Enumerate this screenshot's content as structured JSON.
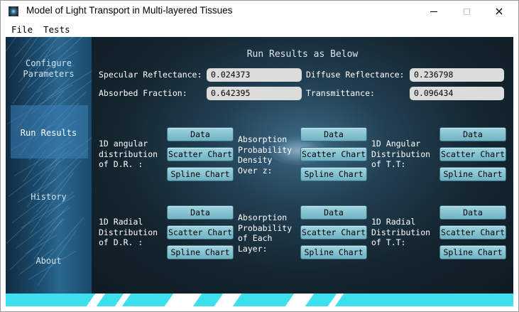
{
  "window": {
    "title": "Model of Light Transport in Multi-layered Tissues"
  },
  "titlebar_buttons": {
    "minimize": "minimize-icon",
    "maximize": "maximize-icon",
    "close": "×"
  },
  "menu": {
    "file": "File",
    "tests": "Tests"
  },
  "sidebar": {
    "items": [
      {
        "label": "Configure\nParameters"
      },
      {
        "label": "Run Results"
      },
      {
        "label": "History"
      },
      {
        "label": "About"
      }
    ],
    "selected_index": 1
  },
  "results": {
    "title": "Run Results as Below",
    "specular_label": "Specular Reflectance:",
    "specular_value": "0.024373",
    "diffuse_label": "Diffuse Reflectance:",
    "diffuse_value": "0.236798",
    "absorbed_label": "Absorbed Fraction:",
    "absorbed_value": "0.642395",
    "transmittance_label": "Transmittance:",
    "transmittance_value": "0.096434"
  },
  "groups": [
    {
      "label": "1D angular\ndistribution\nof D.R. :"
    },
    {
      "label": "Absorption\nProbability\nDensity\nOver z:"
    },
    {
      "label": "1D Angular\nDistribution\nof T.T:"
    },
    {
      "label": "1D Radial\nDistribution\nof D.R. :"
    },
    {
      "label": "Absorption\nProbability\nof Each\nLayer:"
    },
    {
      "label": "1D Radial\nDistribution\nof T.T:"
    }
  ],
  "buttons": {
    "data": "Data",
    "scatter": "Scatter Chart",
    "spline": "Spline Chart"
  },
  "colors": {
    "button": "#86c3d2",
    "footer": "#3fe0ee",
    "background": "#0f1921"
  }
}
